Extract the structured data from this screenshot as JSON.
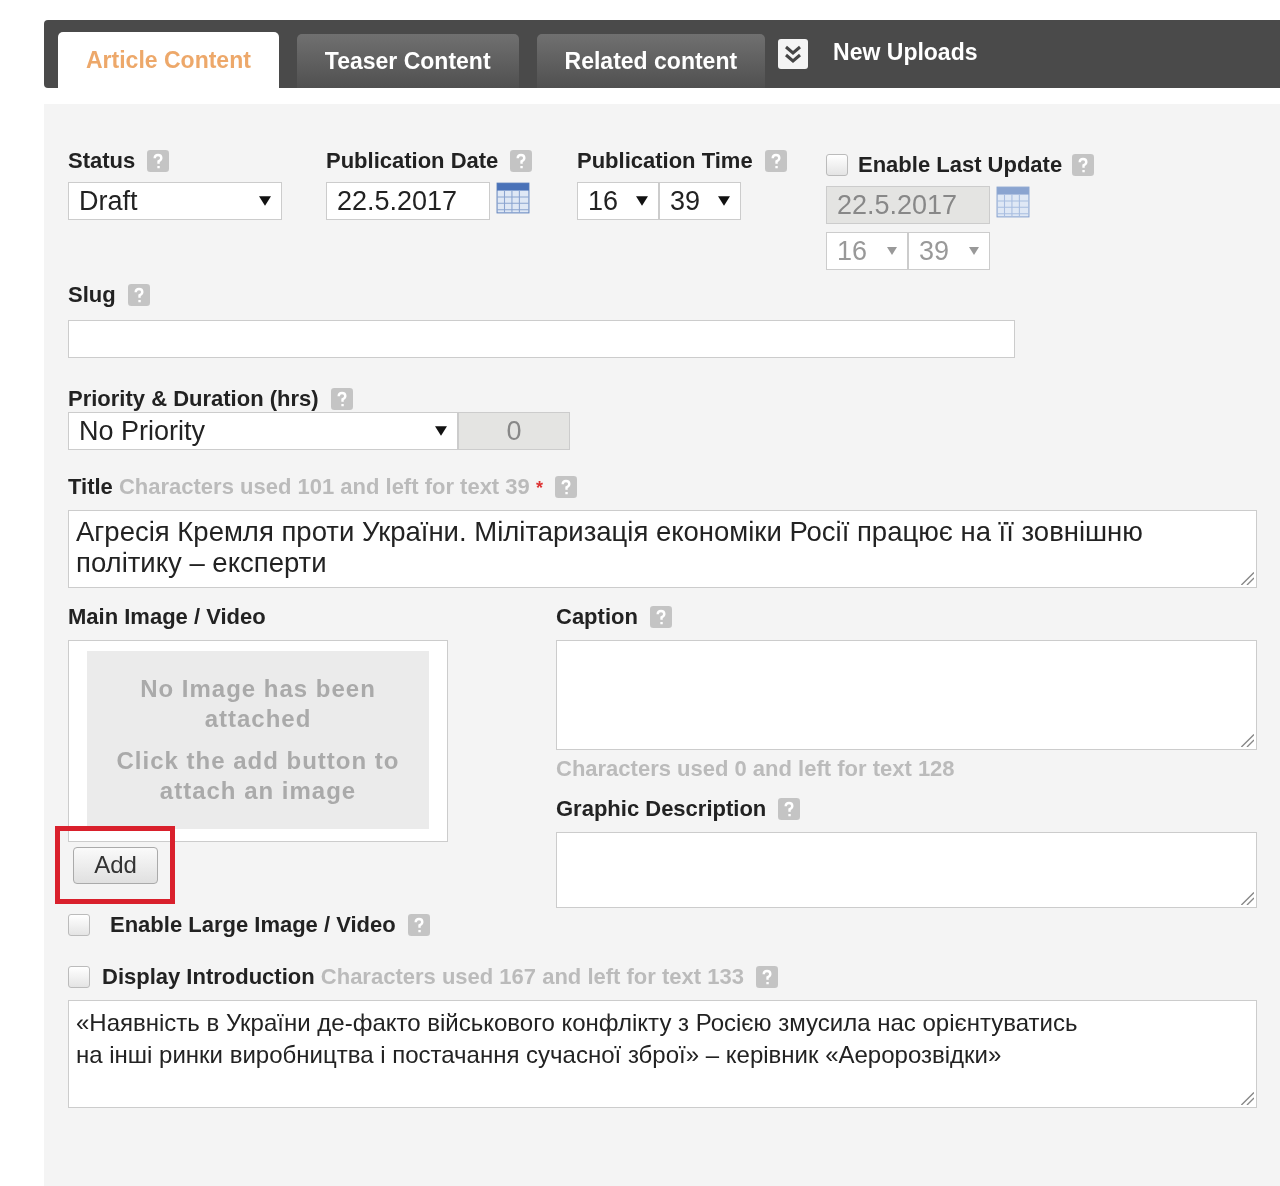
{
  "tabs": [
    {
      "label": "Article Content",
      "selected": true
    },
    {
      "label": "Teaser Content",
      "selected": false
    },
    {
      "label": "Related content",
      "selected": false
    }
  ],
  "new_uploads": {
    "label": "New Uploads"
  },
  "status": {
    "label": "Status",
    "help": true,
    "value": "Draft"
  },
  "publication_date": {
    "label": "Publication Date",
    "help": true,
    "value": "22.5.2017"
  },
  "publication_time": {
    "label": "Publication Time",
    "help": true,
    "hour": "16",
    "minute": "39"
  },
  "last_update": {
    "label": "Enable Last Update",
    "help": true,
    "checked": false,
    "date": "22.5.2017",
    "hour": "16",
    "minute": "39"
  },
  "slug": {
    "label": "Slug",
    "help": true
  },
  "priority": {
    "label": "Priority & Duration (hrs)",
    "help": true,
    "value": "No Priority",
    "duration": "0"
  },
  "title": {
    "label": "Title",
    "counter": "Characters used 101 and left for text 39",
    "required": "*",
    "help": true,
    "value": "Агресія Кремля проти України. Мілітаризація економіки Росії працює на її зовнішню політику – експерти"
  },
  "main_image": {
    "label": "Main Image / Video",
    "empty_lines": [
      "No Image has been attached",
      "Click the add button to attach an image"
    ],
    "add_button": "Add",
    "highlighted": true
  },
  "caption": {
    "label": "Caption",
    "help": true,
    "counter": "Characters used 0 and left for text 128"
  },
  "graphic_description": {
    "label": "Graphic Description",
    "help": true
  },
  "large_image": {
    "label": "Enable Large Image / Video",
    "checked": false,
    "help": true
  },
  "introduction": {
    "label": "Display Introduction",
    "checked": false,
    "counter": "Characters used 167 and left for text 133",
    "help": true,
    "value": "«Наявність в України де-факто військового конфлікту з Росією змусила нас орієнтуватись на інші ринки виробництва і постачання сучасної зброї» – керівник «Аеророзвідки»"
  }
}
